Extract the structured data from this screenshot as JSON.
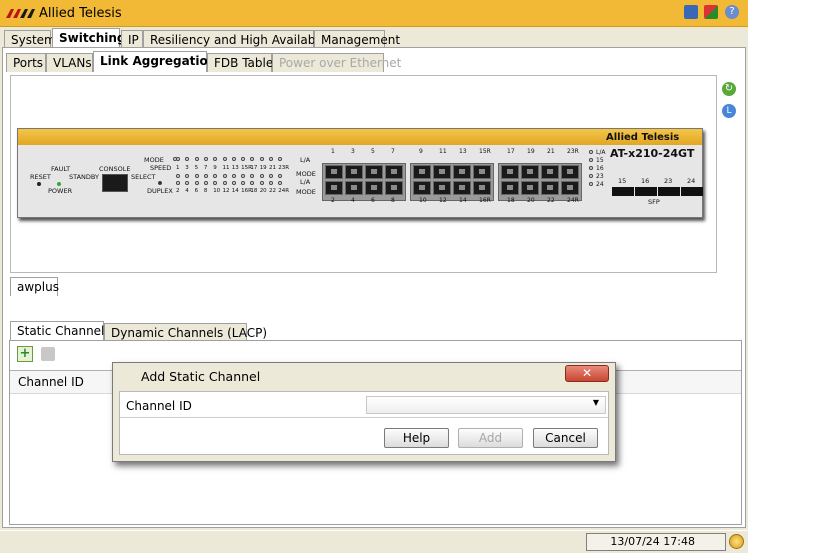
{
  "app": {
    "title": "Allied Telesis"
  },
  "main_tabs": [
    "System",
    "Switching",
    "IP",
    "Resiliency and High Availability",
    "Management"
  ],
  "sub_tabs": [
    "Ports",
    "VLANs",
    "Link Aggregation",
    "FDB Table",
    "Power over Ethernet"
  ],
  "device": {
    "brand": "Allied Telesis",
    "model": "AT-x210-24GT",
    "labels": {
      "fault": "FAULT",
      "reset": "RESET",
      "standby": "STANDBY",
      "power": "POWER",
      "console": "CONSOLE",
      "mode": "MODE",
      "speed": "SPEED",
      "select": "SELECT",
      "duplex": "DUPLEX",
      "la": "L/A",
      "mode_r": "MODE",
      "sfp": "SFP"
    },
    "led_top_numbers": [
      "1",
      "3",
      "5",
      "7",
      "9",
      "11",
      "13",
      "15R",
      "17",
      "19",
      "21",
      "23R"
    ],
    "led_bottom_numbers": [
      "2",
      "4",
      "6",
      "8",
      "10",
      "12",
      "14",
      "16R",
      "18",
      "20",
      "22",
      "24R"
    ],
    "port_top_numbers": [
      "1",
      "3",
      "5",
      "7",
      "9",
      "11",
      "13",
      "15R",
      "17",
      "19",
      "21",
      "23R"
    ],
    "port_bottom_numbers": [
      "2",
      "4",
      "6",
      "8",
      "10",
      "12",
      "14",
      "16R",
      "18",
      "20",
      "22",
      "24R"
    ],
    "sfp_led_labels": [
      "L/A",
      "15",
      "16",
      "23",
      "24"
    ],
    "sfp_numbers": [
      "15",
      "16",
      "23",
      "24"
    ]
  },
  "device_tab": "awplus",
  "channel_tabs": [
    "Static Channels",
    "Dynamic Channels (LACP)"
  ],
  "table": {
    "column_header": "Channel ID"
  },
  "dialog": {
    "title": "Add Static Channel",
    "field_label": "Channel ID",
    "field_value": "",
    "buttons": {
      "help": "Help",
      "add": "Add",
      "cancel": "Cancel"
    }
  },
  "status": {
    "datetime": "13/07/24 17:48"
  },
  "colors": {
    "titlebar": "#f1b935",
    "frame": "#ece9d8",
    "close": "#d9534f"
  }
}
